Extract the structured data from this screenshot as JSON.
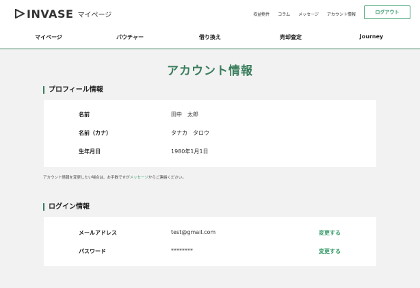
{
  "header": {
    "logo_word": "INVASE",
    "logo_sub": "マイページ",
    "top_links": [
      "収益物件",
      "コラム",
      "メッセージ",
      "アカウント情報"
    ],
    "logout_label": "ログアウト"
  },
  "nav": [
    "マイページ",
    "バウチャー",
    "借り換え",
    "売却査定",
    "Journey"
  ],
  "page_title": "アカウント情報",
  "profile": {
    "heading": "プロフィール情報",
    "rows": [
      {
        "label": "名前",
        "value": "田中　太郎"
      },
      {
        "label": "名前（カナ）",
        "value": "タナカ　タロウ"
      },
      {
        "label": "生年月日",
        "value": "1980年1月1日"
      }
    ]
  },
  "note": {
    "before": "アカウント情報を変更したい場合は、お手数ですが",
    "link": "メッセージ",
    "after": "からご連絡ください。"
  },
  "login": {
    "heading": "ログイン情報",
    "rows": [
      {
        "label": "メールアドレス",
        "value": "test@gmail.com",
        "action": "変更する"
      },
      {
        "label": "パスワード",
        "value": "********",
        "action": "変更する"
      }
    ]
  },
  "colors": {
    "accent": "#3a7d5c",
    "link": "#3a9d6c",
    "background": "#f2f2f2"
  }
}
